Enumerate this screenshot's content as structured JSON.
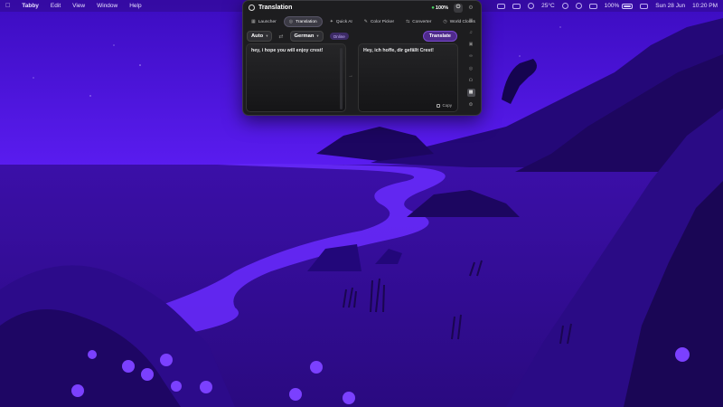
{
  "menubar": {
    "apple_icon": "apple-logo-icon",
    "app_name": "Tabby",
    "menus": [
      "Edit",
      "View",
      "Window",
      "Help"
    ],
    "status": {
      "temperature": "25°C",
      "battery": "100%",
      "date": "Sun 28 Jun",
      "time": "10:20 PM"
    }
  },
  "panel": {
    "title": "Translation",
    "battery": "100%",
    "tabs": [
      {
        "label": "Launcher",
        "icon": "grid-icon",
        "active": false
      },
      {
        "label": "Translation",
        "icon": "globe-icon",
        "active": true
      },
      {
        "label": "Quick AI",
        "icon": "sparkle-icon",
        "active": false
      },
      {
        "label": "Color Picker",
        "icon": "eyedropper-icon",
        "active": false
      },
      {
        "label": "Converter",
        "icon": "convert-icon",
        "active": false
      },
      {
        "label": "World Clocks",
        "icon": "clock-icon",
        "active": false
      }
    ],
    "source_lang": "Auto",
    "target_lang": "German",
    "mode_badge": "Online",
    "translate_label": "Translate",
    "source_text": "hey, i hope you will enjoy crest!",
    "translated_text": "Hey, ich hoffe, dir gefällt Crest!",
    "copy_label": "Copy"
  },
  "colors": {
    "wallpaper_sky": "#4b14d6",
    "wallpaper_sea": "#3a0fa0",
    "panel_bg": "#1d1d1f",
    "accent": "#7a4ad0"
  }
}
